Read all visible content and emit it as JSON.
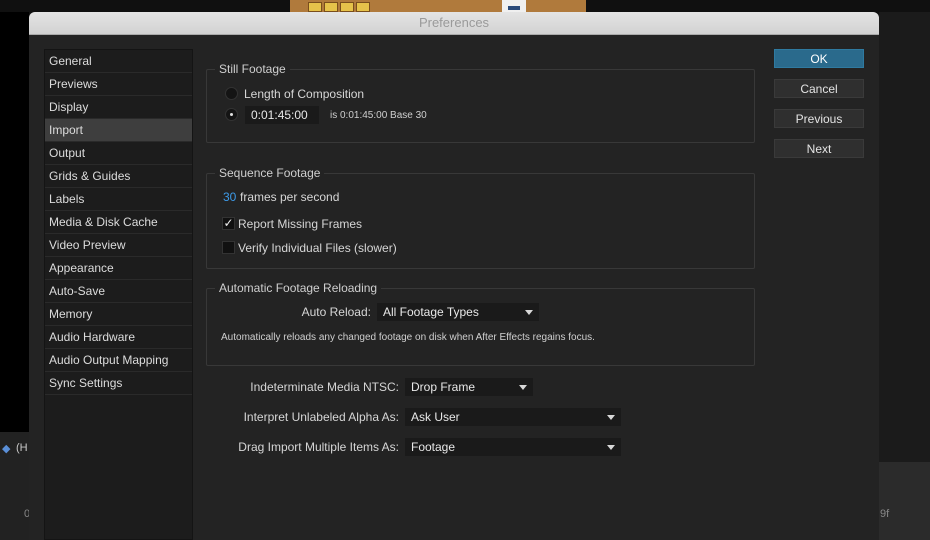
{
  "window": {
    "title": "Preferences"
  },
  "background": {
    "left_text": "(H",
    "left_digit": "0",
    "right_text": "9f"
  },
  "sidebar": {
    "items": [
      {
        "label": "General"
      },
      {
        "label": "Previews"
      },
      {
        "label": "Display"
      },
      {
        "label": "Import",
        "selected": true
      },
      {
        "label": "Output"
      },
      {
        "label": "Grids & Guides"
      },
      {
        "label": "Labels"
      },
      {
        "label": "Media & Disk Cache"
      },
      {
        "label": "Video Preview"
      },
      {
        "label": "Appearance"
      },
      {
        "label": "Auto-Save"
      },
      {
        "label": "Memory"
      },
      {
        "label": "Audio Hardware"
      },
      {
        "label": "Audio Output Mapping"
      },
      {
        "label": "Sync Settings"
      }
    ]
  },
  "still_footage": {
    "title": "Still Footage",
    "option_length": "Length of Composition",
    "duration_value": "0:01:45:00",
    "duration_info": "is 0:01:45:00  Base 30"
  },
  "sequence_footage": {
    "title": "Sequence Footage",
    "fps_value": "30",
    "fps_label": "frames per second",
    "report_missing": "Report Missing Frames",
    "verify_files": "Verify Individual Files (slower)"
  },
  "auto_reload": {
    "title": "Automatic Footage Reloading",
    "label": "Auto Reload:",
    "value": "All Footage Types",
    "description": "Automatically reloads any changed footage on disk when After Effects regains focus."
  },
  "import_options": {
    "ntsc_label": "Indeterminate Media NTSC:",
    "ntsc_value": "Drop Frame",
    "alpha_label": "Interpret Unlabeled Alpha As:",
    "alpha_value": "Ask User",
    "drag_label": "Drag Import Multiple Items As:",
    "drag_value": "Footage"
  },
  "buttons": {
    "ok": "OK",
    "cancel": "Cancel",
    "previous": "Previous",
    "next": "Next"
  },
  "colors": {
    "accent": "#2a6a8c",
    "link_blue": "#3d9be9",
    "dialog_bg": "#232323"
  }
}
